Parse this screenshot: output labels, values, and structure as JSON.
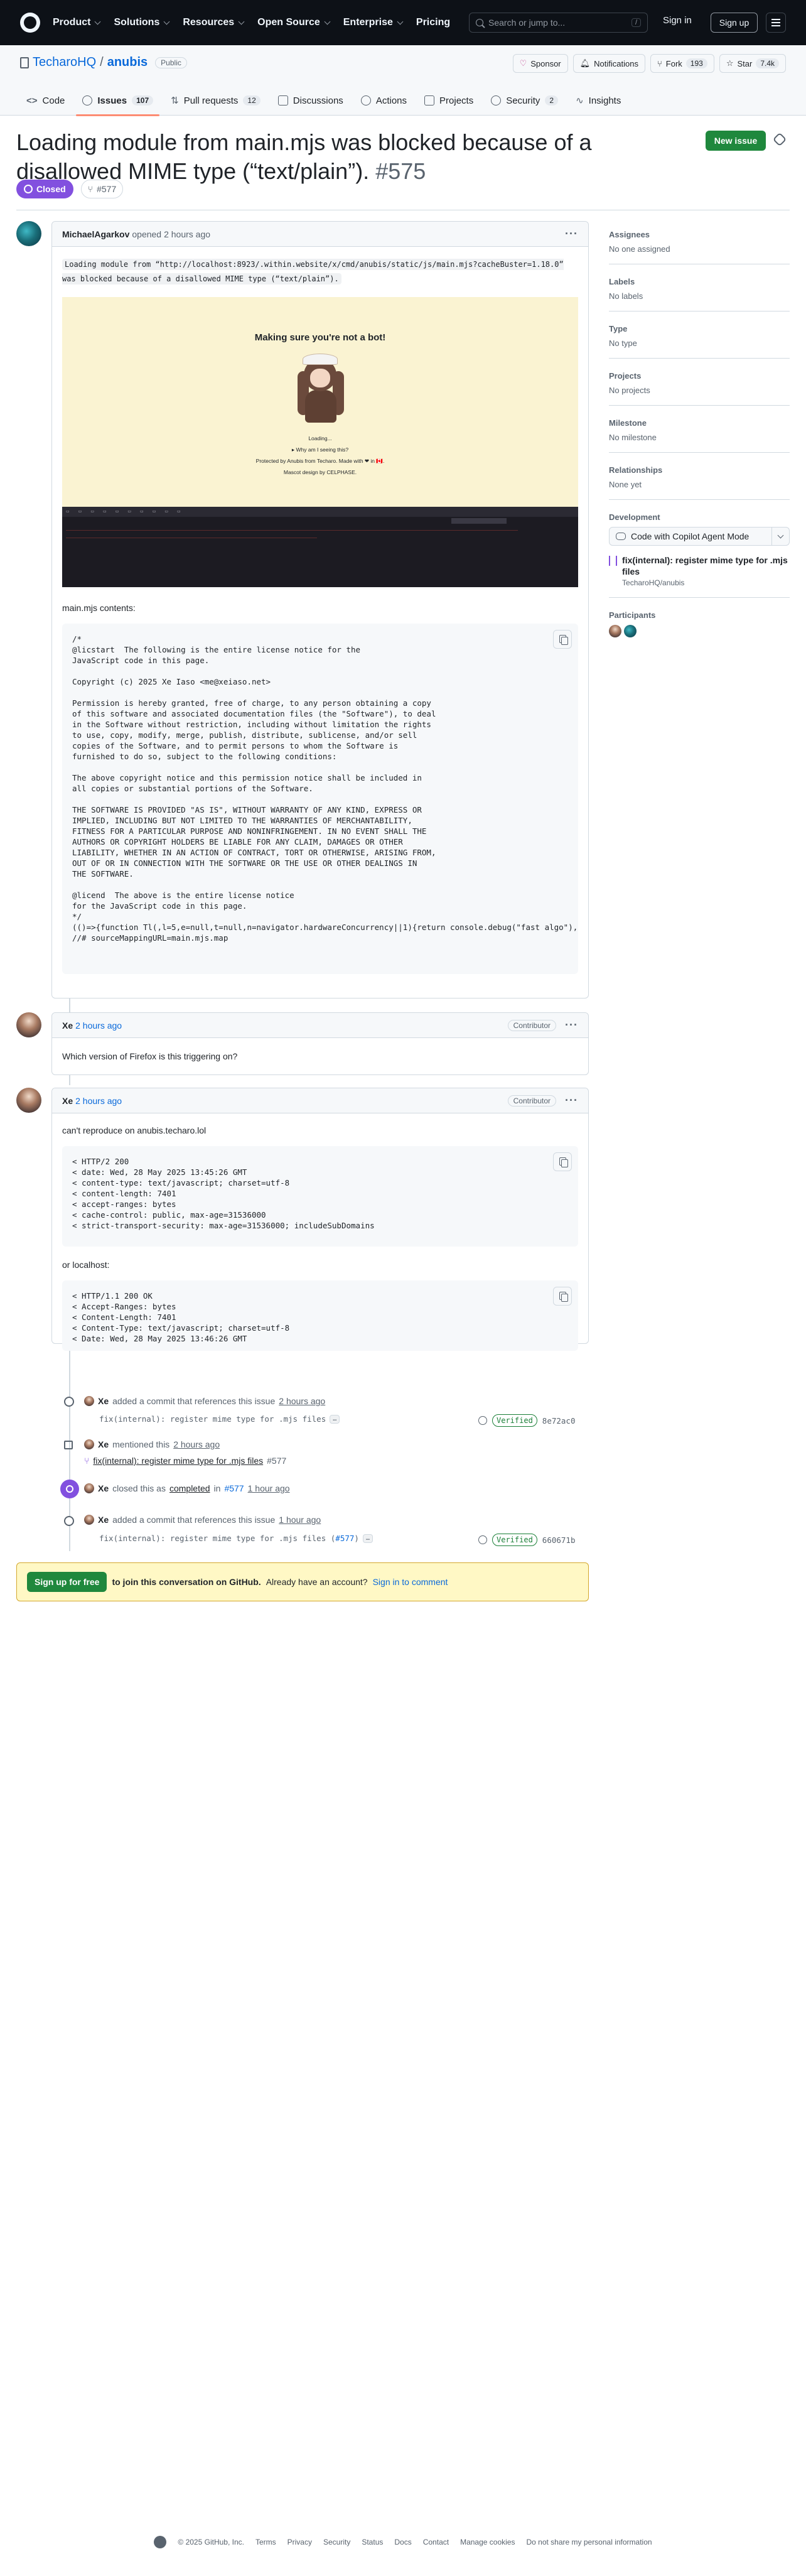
{
  "header": {
    "nav": [
      "Product",
      "Solutions",
      "Resources",
      "Open Source",
      "Enterprise",
      "Pricing"
    ],
    "search_placeholder": "Search or jump to...",
    "search_key": "/",
    "sign_in": "Sign in",
    "sign_up": "Sign up"
  },
  "repo": {
    "owner": "TecharoHQ",
    "separator": "/",
    "name": "anubis",
    "visibility": "Public",
    "sponsor": "Sponsor",
    "notifications": "Notifications",
    "fork": "Fork",
    "fork_count": "193",
    "star": "Star",
    "star_count": "7.4k",
    "tabs": [
      {
        "label": "Code",
        "count": ""
      },
      {
        "label": "Issues",
        "count": "107"
      },
      {
        "label": "Pull requests",
        "count": "12"
      },
      {
        "label": "Discussions",
        "count": ""
      },
      {
        "label": "Actions",
        "count": ""
      },
      {
        "label": "Projects",
        "count": ""
      },
      {
        "label": "Security",
        "count": "2"
      },
      {
        "label": "Insights",
        "count": ""
      }
    ]
  },
  "issue": {
    "title": "Loading module from main.mjs was blocked because of a disallowed MIME type (“text/plain”).",
    "number": "#575",
    "new_issue": "New issue",
    "state": "Closed",
    "linked_pr": "#577"
  },
  "comments": [
    {
      "author": "MichaelAgarkov",
      "action": "opened",
      "time": "2 hours ago",
      "inline_code": "Loading module from “http://localhost:8923/.within.website/x/cmd/anubis/static/js/main.mjs?cacheBuster=1.18.0” was blocked because of a disallowed MIME type (“text/plain”).",
      "screenshot": {
        "title": "Making sure you're not a bot!",
        "loading": "Loading...",
        "why": "▸ Why am I seeing this?",
        "protected_by": "Protected by Anubis from Techaro. Made with ❤ in 🇨🇦.",
        "mascot_design": "Mascot design by CELPHASE."
      },
      "text": "main.mjs contents:",
      "code": "/*\n@licstart  The following is the entire license notice for the\nJavaScript code in this page.\n\nCopyright (c) 2025 Xe Iaso <me@xeiaso.net>\n\nPermission is hereby granted, free of charge, to any person obtaining a copy\nof this software and associated documentation files (the \"Software\"), to deal\nin the Software without restriction, including without limitation the rights\nto use, copy, modify, merge, publish, distribute, sublicense, and/or sell\ncopies of the Software, and to permit persons to whom the Software is\nfurnished to do so, subject to the following conditions:\n\nThe above copyright notice and this permission notice shall be included in\nall copies or substantial portions of the Software.\n\nTHE SOFTWARE IS PROVIDED \"AS IS\", WITHOUT WARRANTY OF ANY KIND, EXPRESS OR\nIMPLIED, INCLUDING BUT NOT LIMITED TO THE WARRANTIES OF MERCHANTABILITY,\nFITNESS FOR A PARTICULAR PURPOSE AND NONINFRINGEMENT. IN NO EVENT SHALL THE\nAUTHORS OR COPYRIGHT HOLDERS BE LIABLE FOR ANY CLAIM, DAMAGES OR OTHER\nLIABILITY, WHETHER IN AN ACTION OF CONTRACT, TORT OR OTHERWISE, ARISING FROM,\nOUT OF OR IN CONNECTION WITH THE SOFTWARE OR THE USE OR OTHER DEALINGS IN\nTHE SOFTWARE.\n\n@licend  The above is the entire license notice\nfor the JavaScript code in this page.\n*/\n(()=>{function Tl(,l=5,e=null,t=null,n=navigator.hardwareConcurrency||1){return console.debug(\"fast algo\"),new Pr\n//# sourceMappingURL=main.mjs.map"
    },
    {
      "author": "Xe",
      "time": "2 hours ago",
      "role": "Contributor",
      "text": "Which version of Firefox is this triggering on?"
    },
    {
      "author": "Xe",
      "time": "2 hours ago",
      "role": "Contributor",
      "text": "can't reproduce on anubis.techaro.lol",
      "code1": "< HTTP/2 200\n< date: Wed, 28 May 2025 13:45:26 GMT\n< content-type: text/javascript; charset=utf-8\n< content-length: 7401\n< accept-ranges: bytes\n< cache-control: public, max-age=31536000\n< strict-transport-security: max-age=31536000; includeSubDomains",
      "text2": "or localhost:",
      "code2": "< HTTP/1.1 200 OK\n< Accept-Ranges: bytes\n< Content-Length: 7401\n< Content-Type: text/javascript; charset=utf-8\n< Date: Wed, 28 May 2025 13:46:26 GMT"
    }
  ],
  "events": {
    "e1": {
      "actor": "Xe",
      "text": "added a commit that references this issue",
      "time": "2 hours ago",
      "commit": "fix(internal): register mime type for .mjs files",
      "verified": "Verified",
      "sha": "8e72ac0"
    },
    "e2": {
      "actor": "Xe",
      "text": "mentioned this",
      "time": "2 hours ago",
      "pr_title": "fix(internal): register mime type for .mjs files",
      "pr_num": "#577"
    },
    "e3": {
      "actor": "Xe",
      "text": "closed this as",
      "completed": "completed",
      "in": "in",
      "pr_num": "#577",
      "time": "1 hour ago"
    },
    "e4": {
      "actor": "Xe",
      "text": "added a commit that references this issue",
      "time": "1 hour ago",
      "commit": "fix(internal): register mime type for .mjs files (",
      "commit_pr": "#577",
      "commit_close": ")",
      "verified": "Verified",
      "sha": "660671b"
    }
  },
  "sidebar": {
    "assignees": {
      "title": "Assignees",
      "value": "No one assigned"
    },
    "labels": {
      "title": "Labels",
      "value": "No labels"
    },
    "type": {
      "title": "Type",
      "value": "No type"
    },
    "projects": {
      "title": "Projects",
      "value": "No projects"
    },
    "milestone": {
      "title": "Milestone",
      "value": "No milestone"
    },
    "relationships": {
      "title": "Relationships",
      "value": "None yet"
    },
    "development": {
      "title": "Development",
      "copilot": "Code with Copilot Agent Mode",
      "pr_title": "fix(internal): register mime type for .mjs files",
      "pr_repo": "TecharoHQ/anubis"
    },
    "participants": {
      "title": "Participants"
    }
  },
  "signup": {
    "button": "Sign up for free",
    "bold": "to join this conversation on GitHub.",
    "text": "Already have an account?",
    "link": "Sign in to comment"
  },
  "footer": {
    "copyright": "© 2025 GitHub, Inc.",
    "links": [
      "Terms",
      "Privacy",
      "Security",
      "Status",
      "Docs",
      "Contact",
      "Manage cookies",
      "Do not share my personal information"
    ]
  }
}
